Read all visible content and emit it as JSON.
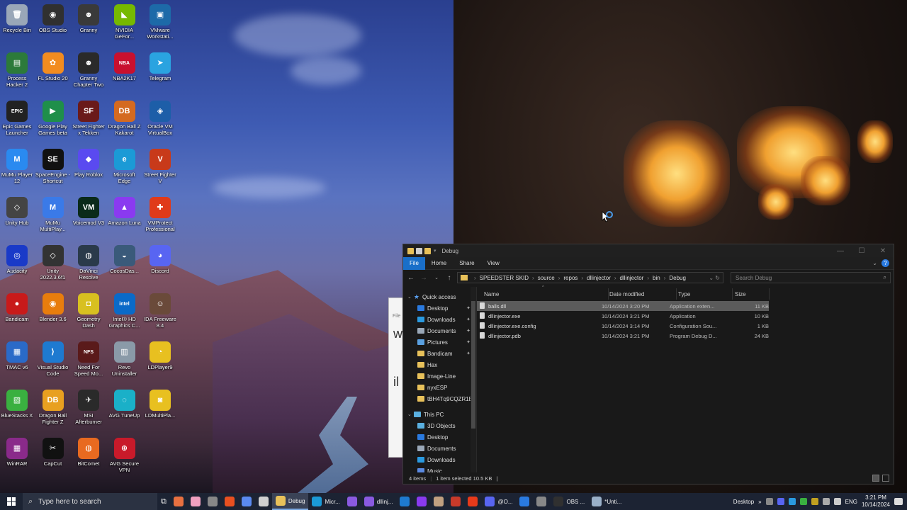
{
  "desktop": {
    "icons": [
      {
        "label": "Recycle Bin",
        "glyph": "🗑",
        "color": "#9aa7b8"
      },
      {
        "label": "OBS Studio",
        "glyph": "◉",
        "color": "#303030"
      },
      {
        "label": "Granny",
        "glyph": "☻",
        "color": "#3a3a3a"
      },
      {
        "label": "NVIDIA GeFor...",
        "glyph": "◣",
        "color": "#76b900"
      },
      {
        "label": "VMware Workstati...",
        "glyph": "▣",
        "color": "#1d6aa8"
      },
      {
        "label": "Process Hacker 2",
        "glyph": "▤",
        "color": "#2c7a3a"
      },
      {
        "label": "FL Studio 20",
        "glyph": "✿",
        "color": "#f28c20"
      },
      {
        "label": "Granny Chapter Two",
        "glyph": "☻",
        "color": "#2a2a2a"
      },
      {
        "label": "NBA2K17",
        "glyph": "NBA",
        "color": "#c8102e"
      },
      {
        "label": "Telegram",
        "glyph": "➤",
        "color": "#2aa3e0"
      },
      {
        "label": "Epic Games Launcher",
        "glyph": "EPIC",
        "color": "#222"
      },
      {
        "label": "Google Play Games beta",
        "glyph": "▶",
        "color": "#1f8f4a"
      },
      {
        "label": "Street Fighter x Tekken",
        "glyph": "SF",
        "color": "#6a1a1a"
      },
      {
        "label": "Dragon Ball Z Kakarot",
        "glyph": "DB",
        "color": "#d46a20"
      },
      {
        "label": "Oracle VM VirtualBox",
        "glyph": "◈",
        "color": "#1d5ea8"
      },
      {
        "label": "MuMu Player 12",
        "glyph": "M",
        "color": "#2a8af0"
      },
      {
        "label": "SpaceEngine - Shortcut",
        "glyph": "SE",
        "color": "#111"
      },
      {
        "label": "Play Roblox",
        "glyph": "◆",
        "color": "#5a4af0"
      },
      {
        "label": "Microsoft Edge",
        "glyph": "e",
        "color": "#1b9ad6"
      },
      {
        "label": "Street Fighter V",
        "glyph": "V",
        "color": "#c83a1a"
      },
      {
        "label": "Unity Hub",
        "glyph": "◇",
        "color": "#444"
      },
      {
        "label": "MuMu MultiPlay...",
        "glyph": "M",
        "color": "#3a7ae8"
      },
      {
        "label": "Voicemod V3",
        "glyph": "VM",
        "color": "#0a2a1a"
      },
      {
        "label": "Amazon Luna",
        "glyph": "▲",
        "color": "#8a3af0"
      },
      {
        "label": "VMProtect Professional",
        "glyph": "✚",
        "color": "#e03a1a"
      },
      {
        "label": "Audacity",
        "glyph": "◎",
        "color": "#1a3ac8"
      },
      {
        "label": "Unity 2022.3.6f1",
        "glyph": "◇",
        "color": "#333"
      },
      {
        "label": "DaVinci Resolve",
        "glyph": "◍",
        "color": "#2a3a4a"
      },
      {
        "label": "CocosDas...",
        "glyph": "◒",
        "color": "#3a5a7a"
      },
      {
        "label": "Discord",
        "glyph": "◕",
        "color": "#5865f2"
      },
      {
        "label": "Bandicam",
        "glyph": "●",
        "color": "#c81a1a"
      },
      {
        "label": "Blender 3.6",
        "glyph": "◉",
        "color": "#e87d0d"
      },
      {
        "label": "Geometry Dash",
        "glyph": "◘",
        "color": "#d8c020"
      },
      {
        "label": "Intel® HD Graphics C...",
        "glyph": "intel",
        "color": "#0a6ac8"
      },
      {
        "label": "IDA Freeware 8.4",
        "glyph": "☺",
        "color": "#6a4a3a"
      },
      {
        "label": "TMAC v6",
        "glyph": "▦",
        "color": "#2a6ac8"
      },
      {
        "label": "Visual Studio Code",
        "glyph": "⟩",
        "color": "#1e7ad0"
      },
      {
        "label": "Need For Speed Mo...",
        "glyph": "NFS",
        "color": "#5a1a1a"
      },
      {
        "label": "Revo Uninstaller",
        "glyph": "▥",
        "color": "#8a9aa8"
      },
      {
        "label": "LDPlayer9",
        "glyph": "◔",
        "color": "#e8c020"
      },
      {
        "label": "BlueStacks X",
        "glyph": "▧",
        "color": "#3ab040"
      },
      {
        "label": "Dragon Ball Fighter Z",
        "glyph": "DB",
        "color": "#e8a020"
      },
      {
        "label": "MSI Afterburner",
        "glyph": "✈",
        "color": "#2a2a2a"
      },
      {
        "label": "AVG TuneUp",
        "glyph": "◌",
        "color": "#1ab0c8"
      },
      {
        "label": "LDMultiPla...",
        "glyph": "◙",
        "color": "#e8c020"
      },
      {
        "label": "WinRAR",
        "glyph": "▦",
        "color": "#8a2a8a"
      },
      {
        "label": "CapCut",
        "glyph": "✂",
        "color": "#111"
      },
      {
        "label": "BitComet",
        "glyph": "◍",
        "color": "#e86a20"
      },
      {
        "label": "AVG Secure VPN",
        "glyph": "⊕",
        "color": "#c81a2a"
      }
    ]
  },
  "back_window": {
    "line0": "File",
    "line1": "w",
    "line2": "il"
  },
  "explorer": {
    "title": "Debug",
    "ribbon_tabs": [
      "File",
      "Home",
      "Share",
      "View"
    ],
    "breadcrumb": [
      "SPEEDSTER SKID",
      "source",
      "repos",
      "dllinjector",
      "dllinjector",
      "bin",
      "Debug"
    ],
    "search_placeholder": "Search Debug",
    "columns": {
      "name": "Name",
      "date": "Date modified",
      "type": "Type",
      "size": "Size"
    },
    "nav": {
      "quick_access": "Quick access",
      "items": [
        {
          "label": "Desktop",
          "color": "#2a7ae0",
          "pinned": true
        },
        {
          "label": "Downloads",
          "color": "#2a9ae0",
          "pinned": true
        },
        {
          "label": "Documents",
          "color": "#9aa8b8",
          "pinned": true
        },
        {
          "label": "Pictures",
          "color": "#5aa0e0",
          "pinned": true
        },
        {
          "label": "Bandicam",
          "color": "#e8c15a",
          "pinned": true
        },
        {
          "label": "Hax",
          "color": "#e8c15a",
          "pinned": false
        },
        {
          "label": "Image-Line",
          "color": "#e8c15a",
          "pinned": false
        },
        {
          "label": "nyxESP",
          "color": "#e8c15a",
          "pinned": false
        },
        {
          "label": "tBH4Tq9CQZR1E",
          "color": "#e8c15a",
          "pinned": false
        }
      ],
      "this_pc": "This PC",
      "pc_items": [
        {
          "label": "3D Objects",
          "color": "#5ab0e0"
        },
        {
          "label": "Desktop",
          "color": "#2a7ae0"
        },
        {
          "label": "Documents",
          "color": "#9aa8b8"
        },
        {
          "label": "Downloads",
          "color": "#2a9ae0"
        },
        {
          "label": "Music",
          "color": "#5a8ae0"
        }
      ]
    },
    "files": [
      {
        "name": "balls.dll",
        "date": "10/14/2024 3:20 PM",
        "type": "Application exten...",
        "size": "11 KB",
        "selected": true
      },
      {
        "name": "dllinjector.exe",
        "date": "10/14/2024 3:21 PM",
        "type": "Application",
        "size": "10 KB",
        "selected": false
      },
      {
        "name": "dllinjector.exe.config",
        "date": "10/14/2024 3:14 PM",
        "type": "Configuration Sou...",
        "size": "1 KB",
        "selected": false
      },
      {
        "name": "dllinjector.pdb",
        "date": "10/14/2024 3:21 PM",
        "type": "Program Debug D...",
        "size": "24 KB",
        "selected": false
      }
    ],
    "status": {
      "count": "4 items",
      "selected": "1 item selected  10.5 KB"
    }
  },
  "taskbar": {
    "search_placeholder": "Type here to search",
    "apps": [
      {
        "label": "",
        "color": "#e87040"
      },
      {
        "label": "",
        "color": "#f0a0c0"
      },
      {
        "label": "",
        "color": "#888"
      },
      {
        "label": "",
        "color": "#e85020"
      },
      {
        "label": "",
        "color": "#5a8af0"
      },
      {
        "label": "",
        "color": "#d0d0d0"
      },
      {
        "label": "Debug",
        "color": "#e8c15a",
        "active": true
      },
      {
        "label": "Micr...",
        "color": "#1b9ad6"
      },
      {
        "label": "",
        "color": "#8a5ae0"
      },
      {
        "label": "dllinj...",
        "color": "#8a5ae0"
      },
      {
        "label": "",
        "color": "#1e7ad0"
      },
      {
        "label": "",
        "color": "#8a3af0"
      },
      {
        "label": "",
        "color": "#c0a080"
      },
      {
        "label": "",
        "color": "#c83a2a"
      },
      {
        "label": "",
        "color": "#e83a1a"
      },
      {
        "label": "@O...",
        "color": "#5865f2"
      },
      {
        "label": "",
        "color": "#2a7ae0"
      },
      {
        "label": "",
        "color": "#888"
      },
      {
        "label": "OBS ...",
        "color": "#303030"
      },
      {
        "label": "*Unti...",
        "color": "#9ab0c8"
      }
    ],
    "desktop_label": "Desktop",
    "lang": "ENG",
    "time": "3:21 PM",
    "date": "10/14/2024"
  }
}
